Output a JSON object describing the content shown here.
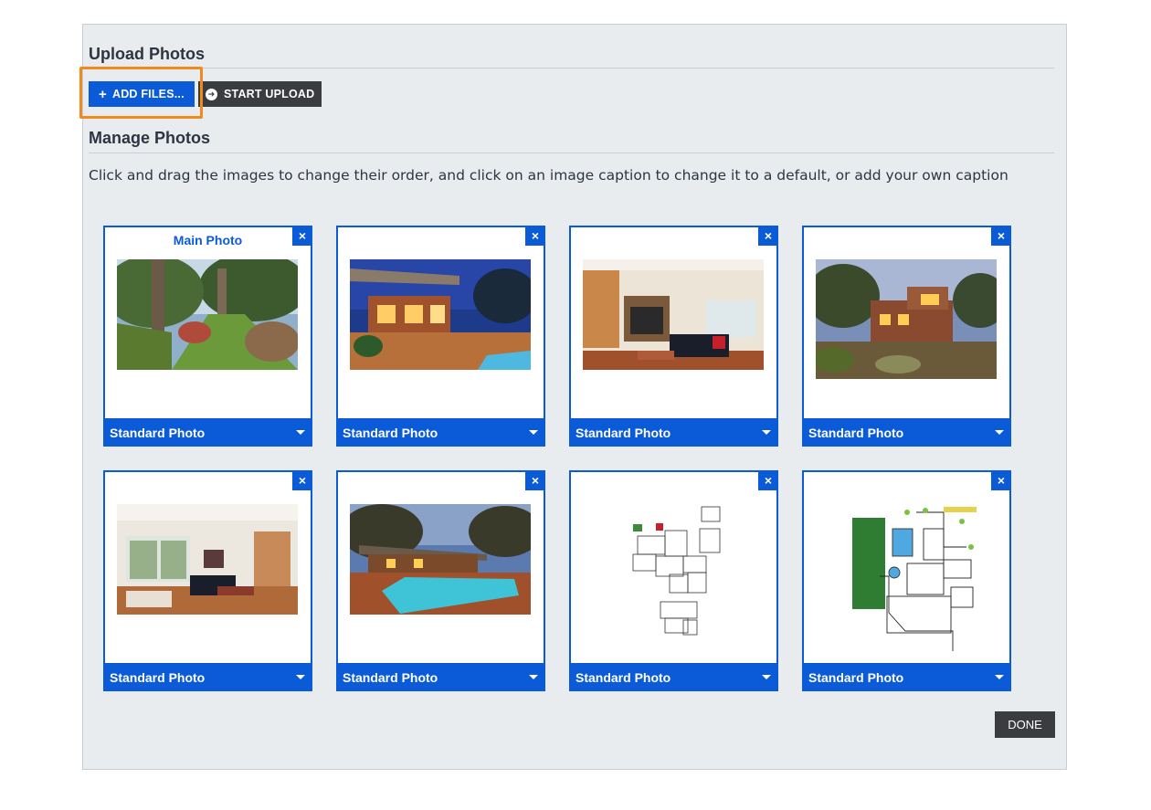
{
  "upload": {
    "title": "Upload Photos",
    "add_files_label": "ADD FILES...",
    "start_upload_label": "START UPLOAD"
  },
  "manage": {
    "title": "Manage Photos",
    "instructions": "Click and drag the images to change their order, and click on an image caption to change it to a default, or add your own caption"
  },
  "photos": [
    {
      "label": "Main Photo",
      "caption": "Standard Photo",
      "close": "×",
      "subject": "garden-lawn"
    },
    {
      "label": "",
      "caption": "Standard Photo",
      "close": "×",
      "subject": "house-courtyard-dusk"
    },
    {
      "label": "",
      "caption": "Standard Photo",
      "close": "×",
      "subject": "living-room-fireplace"
    },
    {
      "label": "",
      "caption": "Standard Photo",
      "close": "×",
      "subject": "house-exterior-dusk"
    },
    {
      "label": "",
      "caption": "Standard Photo",
      "close": "×",
      "subject": "living-room-windows"
    },
    {
      "label": "",
      "caption": "Standard Photo",
      "close": "×",
      "subject": "pool-night"
    },
    {
      "label": "",
      "caption": "Standard Photo",
      "close": "×",
      "subject": "floor-plan"
    },
    {
      "label": "",
      "caption": "Standard Photo",
      "close": "×",
      "subject": "site-plan"
    }
  ],
  "done_label": "DONE",
  "colors": {
    "accent": "#0b5bd9",
    "dark_button": "#3a3c3f",
    "highlight": "#f08a1c",
    "panel": "#e8ecef"
  }
}
